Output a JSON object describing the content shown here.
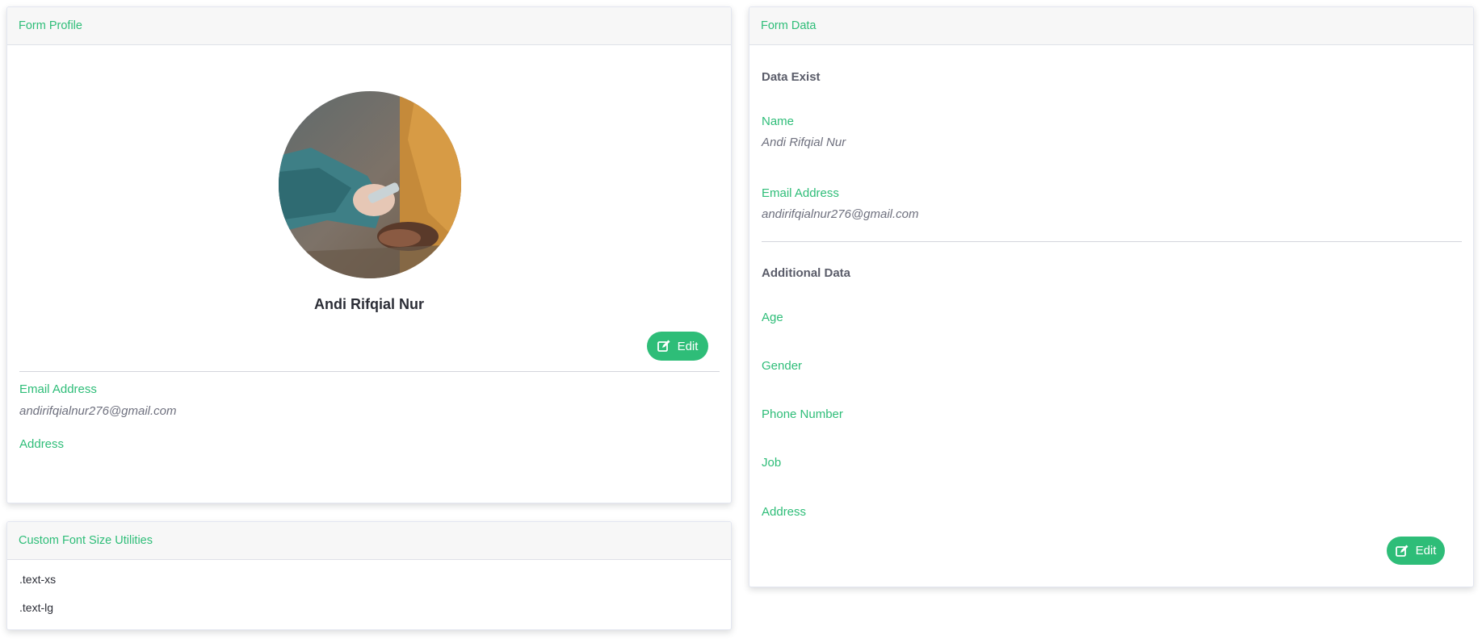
{
  "profile_card": {
    "header": "Form Profile",
    "name": "Andi Rifqial Nur",
    "edit_label": "Edit",
    "email_label": "Email Address",
    "email_value": "andirifqialnur276@gmail.com",
    "address_label": "Address"
  },
  "utilities_card": {
    "header": "Custom Font Size Utilities",
    "items": [
      ".text-xs",
      ".text-lg"
    ]
  },
  "data_card": {
    "header": "Form Data",
    "exist_title": "Data Exist",
    "name_label": "Name",
    "name_value": "Andi Rifqial Nur",
    "email_label": "Email Address",
    "email_value": "andirifqialnur276@gmail.com",
    "additional_title": "Additional Data",
    "age_label": "Age",
    "gender_label": "Gender",
    "phone_label": "Phone Number",
    "job_label": "Job",
    "address_label": "Address",
    "edit_label": "Edit"
  },
  "icons": {
    "edit": "edit-icon",
    "avatar": "profile-photo"
  },
  "colors": {
    "accent": "#2ebd78",
    "header_bg": "#f7f7f7",
    "text": "#6e707e"
  }
}
